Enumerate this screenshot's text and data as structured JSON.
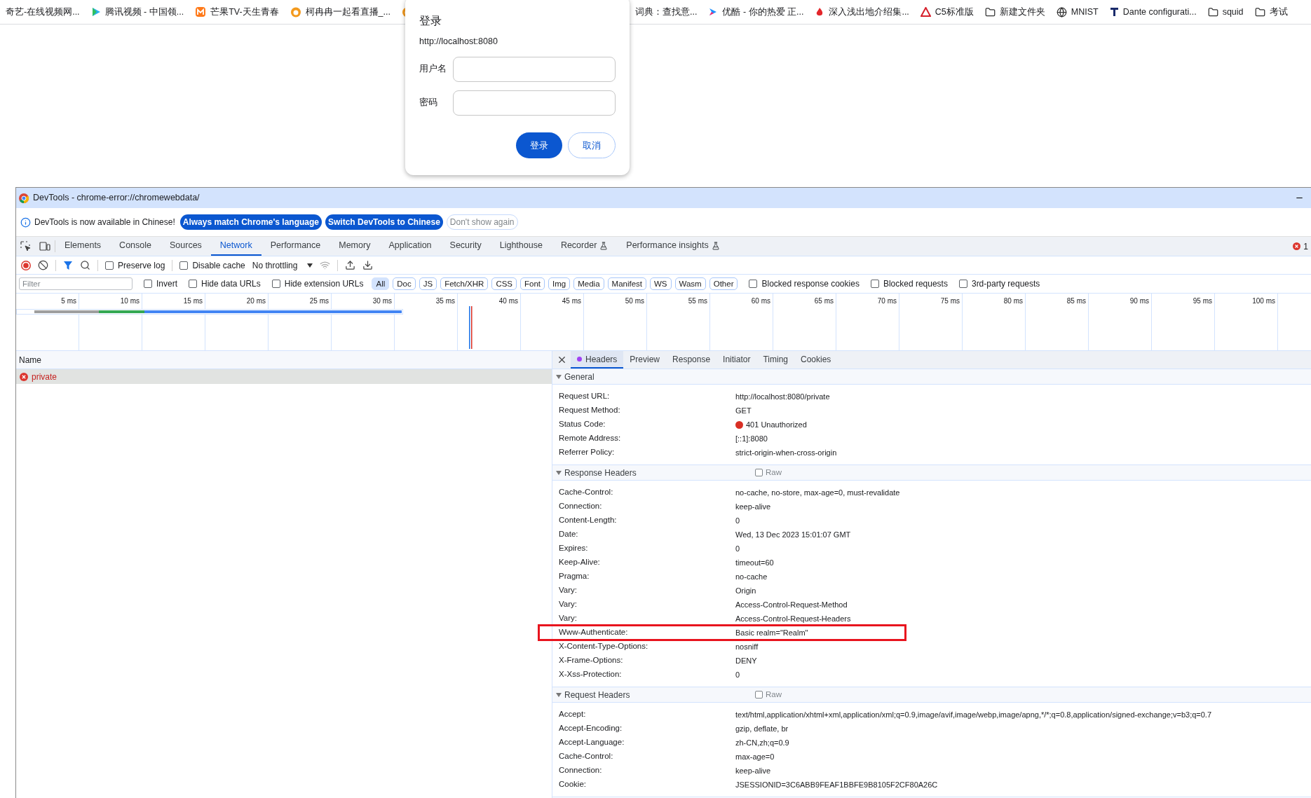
{
  "bookmarks": [
    {
      "kind": "none",
      "label": "奇艺-在线视频网..."
    },
    {
      "kind": "play",
      "label": "腾讯视频 - 中国领..."
    },
    {
      "kind": "mango",
      "label": "芒果TV-天生青春"
    },
    {
      "kind": "face",
      "label": "柯冉冉一起看直播_..."
    },
    {
      "kind": "face"
    }
  ],
  "bookmarks_right": [
    {
      "kind": "none",
      "label": "词典：查找意..."
    },
    {
      "kind": "arrow",
      "label": "优酷 - 你的热爱 正..."
    },
    {
      "kind": "flame",
      "label": "深入浅出地介绍集..."
    },
    {
      "kind": "triangle",
      "label": "C5标准版"
    },
    {
      "kind": "folder",
      "label": "新建文件夹"
    },
    {
      "kind": "globe",
      "label": "MNIST"
    },
    {
      "kind": "bar",
      "label": "Dante configurati..."
    },
    {
      "kind": "folder",
      "label": "squid"
    },
    {
      "kind": "folder",
      "label": "考试"
    }
  ],
  "dialog": {
    "title": "登录",
    "origin": "http://localhost:8080",
    "fields": [
      {
        "label": "用户名"
      },
      {
        "label": "密码"
      }
    ],
    "buttons": [
      {
        "label": "登录",
        "primary": true
      },
      {
        "label": "取消",
        "primary": false
      }
    ]
  },
  "devtools": {
    "title": "DevTools - chrome-error://chromewebdata/",
    "infobar": {
      "message": "DevTools is now available in Chinese!",
      "buttons": [
        {
          "label": "Always match Chrome's language",
          "primary": true
        },
        {
          "label": "Switch DevTools to Chinese",
          "primary": true
        },
        {
          "label": "Don't show again",
          "primary": false
        }
      ]
    },
    "tabs": [
      {
        "label": "Elements",
        "selected": false,
        "experimental": false
      },
      {
        "label": "Console",
        "selected": false,
        "experimental": false
      },
      {
        "label": "Sources",
        "selected": false,
        "experimental": false
      },
      {
        "label": "Network",
        "selected": true,
        "experimental": false
      },
      {
        "label": "Performance",
        "selected": false,
        "experimental": false
      },
      {
        "label": "Memory",
        "selected": false,
        "experimental": false
      },
      {
        "label": "Application",
        "selected": false,
        "experimental": false
      },
      {
        "label": "Security",
        "selected": false,
        "experimental": false
      },
      {
        "label": "Lighthouse",
        "selected": false,
        "experimental": false
      },
      {
        "label": "Recorder",
        "selected": false,
        "experimental": true
      },
      {
        "label": "Performance insights",
        "selected": false,
        "experimental": true
      }
    ],
    "error_count": "1",
    "toolbar": {
      "preserve_log": {
        "label": "Preserve log",
        "checked": false
      },
      "disable_cache": {
        "label": "Disable cache",
        "checked": false
      },
      "throttling": "No throttling"
    },
    "filter": {
      "placeholder": "Filter",
      "checkboxes": [
        {
          "label": "Invert",
          "checked": false
        },
        {
          "label": "Hide data URLs",
          "checked": false
        },
        {
          "label": "Hide extension URLs",
          "checked": false
        }
      ],
      "types": [
        {
          "label": "All",
          "selected": true
        },
        {
          "label": "Doc",
          "selected": false
        },
        {
          "label": "JS",
          "selected": false
        },
        {
          "label": "Fetch/XHR",
          "selected": false
        },
        {
          "label": "CSS",
          "selected": false
        },
        {
          "label": "Font",
          "selected": false
        },
        {
          "label": "Img",
          "selected": false
        },
        {
          "label": "Media",
          "selected": false
        },
        {
          "label": "Manifest",
          "selected": false
        },
        {
          "label": "WS",
          "selected": false
        },
        {
          "label": "Wasm",
          "selected": false
        },
        {
          "label": "Other",
          "selected": false
        }
      ],
      "more_checkboxes": [
        {
          "label": "Blocked response cookies",
          "checked": false
        },
        {
          "label": "Blocked requests",
          "checked": false
        },
        {
          "label": "3rd-party requests",
          "checked": false
        }
      ]
    },
    "timeline_ticks": [
      "5 ms",
      "10 ms",
      "15 ms",
      "20 ms",
      "25 ms",
      "30 ms",
      "35 ms",
      "40 ms",
      "45 ms",
      "50 ms",
      "55 ms",
      "60 ms",
      "65 ms",
      "70 ms",
      "75 ms",
      "80 ms",
      "85 ms",
      "90 ms",
      "95 ms",
      "100 ms"
    ],
    "requests": {
      "column": "Name",
      "rows": [
        {
          "name": "private",
          "failed": true,
          "selected": true
        }
      ]
    },
    "details": {
      "tabs": [
        {
          "label": "Headers",
          "selected": true
        },
        {
          "label": "Preview",
          "selected": false
        },
        {
          "label": "Response",
          "selected": false
        },
        {
          "label": "Initiator",
          "selected": false
        },
        {
          "label": "Timing",
          "selected": false
        },
        {
          "label": "Cookies",
          "selected": false
        }
      ],
      "sections": [
        {
          "title": "General",
          "expanded": true,
          "rows": [
            {
              "name": "Request URL:",
              "value": "http://localhost:8080/private",
              "highlighted": false
            },
            {
              "name": "Request Method:",
              "value": "GET",
              "highlighted": false
            },
            {
              "name": "Status Code:",
              "value": "401 Unauthorized",
              "color": "#d93025",
              "highlighted": false
            },
            {
              "name": "Remote Address:",
              "value": "[::1]:8080",
              "highlighted": false
            },
            {
              "name": "Referrer Policy:",
              "value": "strict-origin-when-cross-origin",
              "highlighted": false
            }
          ]
        },
        {
          "title": "Response Headers",
          "expanded": true,
          "raw": {
            "label": "Raw",
            "checked": false
          },
          "rows": [
            {
              "name": "Cache-Control:",
              "value": "no-cache, no-store, max-age=0, must-revalidate",
              "highlighted": false
            },
            {
              "name": "Connection:",
              "value": "keep-alive",
              "highlighted": false
            },
            {
              "name": "Content-Length:",
              "value": "0",
              "highlighted": false
            },
            {
              "name": "Date:",
              "value": "Wed, 13 Dec 2023 15:01:07 GMT",
              "highlighted": false
            },
            {
              "name": "Expires:",
              "value": "0",
              "highlighted": false
            },
            {
              "name": "Keep-Alive:",
              "value": "timeout=60",
              "highlighted": false
            },
            {
              "name": "Pragma:",
              "value": "no-cache",
              "highlighted": false
            },
            {
              "name": "Vary:",
              "value": "Origin",
              "highlighted": false
            },
            {
              "name": "Vary:",
              "value": "Access-Control-Request-Method",
              "highlighted": false
            },
            {
              "name": "Vary:",
              "value": "Access-Control-Request-Headers",
              "highlighted": false
            },
            {
              "name": "Www-Authenticate:",
              "value": "Basic realm=\"Realm\"",
              "highlighted": true
            },
            {
              "name": "X-Content-Type-Options:",
              "value": "nosniff",
              "highlighted": false
            },
            {
              "name": "X-Frame-Options:",
              "value": "DENY",
              "highlighted": false
            },
            {
              "name": "X-Xss-Protection:",
              "value": "0",
              "highlighted": false
            }
          ]
        },
        {
          "title": "Request Headers",
          "expanded": true,
          "raw": {
            "label": "Raw",
            "checked": false
          },
          "rows": [
            {
              "name": "Accept:",
              "value": "text/html,application/xhtml+xml,application/xml;q=0.9,image/avif,image/webp,image/apng,*/*;q=0.8,application/signed-exchange;v=b3;q=0.7",
              "highlighted": false
            },
            {
              "name": "Accept-Encoding:",
              "value": "gzip, deflate, br",
              "highlighted": false
            },
            {
              "name": "Accept-Language:",
              "value": "zh-CN,zh;q=0.9",
              "highlighted": false
            },
            {
              "name": "Cache-Control:",
              "value": "max-age=0",
              "highlighted": false
            },
            {
              "name": "Connection:",
              "value": "keep-alive",
              "highlighted": false
            },
            {
              "name": "Cookie:",
              "value": "JSESSIONID=3C6ABB9FEAF1BBFE9B8105F2CF80A26C",
              "highlighted": false
            }
          ]
        }
      ]
    }
  }
}
